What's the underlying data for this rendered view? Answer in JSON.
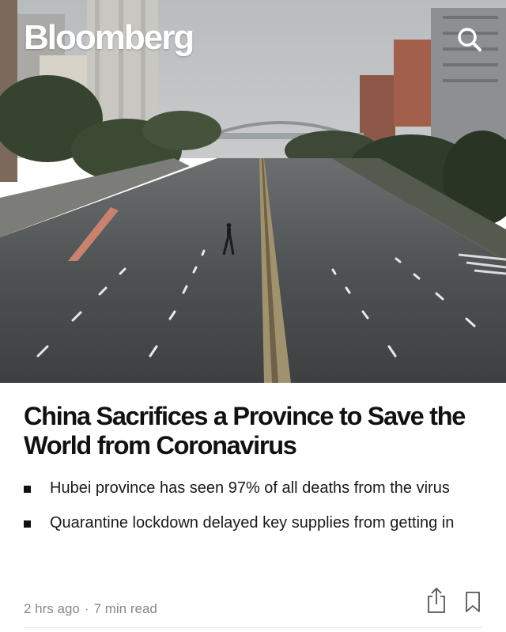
{
  "header": {
    "logo_text": "Bloomberg",
    "search_icon": "search-icon"
  },
  "hero": {
    "description_icon": "photo"
  },
  "article": {
    "headline": "China Sacrifices a Province to Save the World from Coronavirus",
    "bullets": [
      "Hubei province has seen 97% of all deaths from the virus",
      "Quarantine lockdown delayed key supplies from getting in"
    ],
    "time_ago": "2 hrs ago",
    "separator": "·",
    "read_time": "7 min read"
  },
  "actions": {
    "share_icon": "share-icon",
    "bookmark_icon": "bookmark-icon"
  },
  "colors": {
    "text": "#111111",
    "meta": "#888888",
    "background": "#ffffff"
  }
}
